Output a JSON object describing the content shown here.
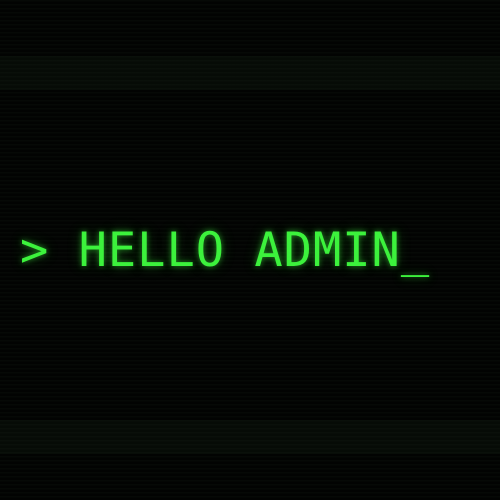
{
  "terminal": {
    "prompt_symbol": ">",
    "message": "HELLO ADMIN",
    "cursor": "_",
    "text_color": "#3cf23c",
    "background_color": "#000000"
  }
}
